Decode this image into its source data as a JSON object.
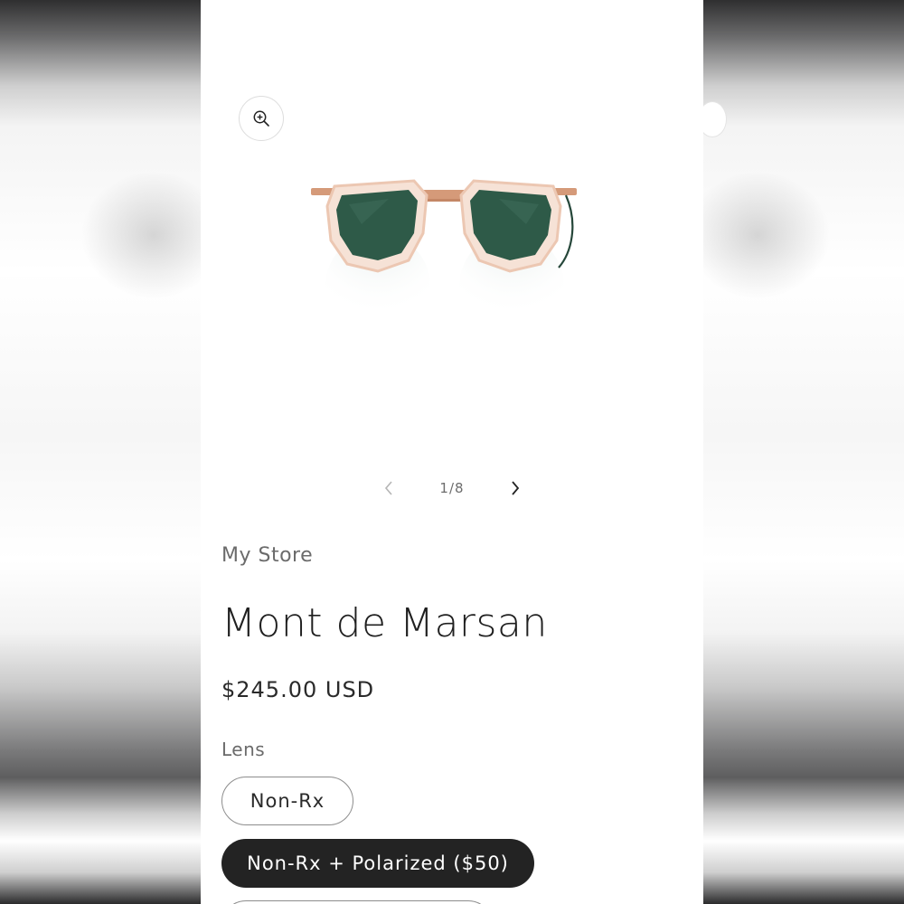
{
  "slider": {
    "counter": "1/8"
  },
  "product": {
    "store": "My Store",
    "title": "Mont de Marsan",
    "price": "$245.00 USD"
  },
  "options": {
    "label": "Lens",
    "values": [
      {
        "label": "Non-Rx",
        "selected": false
      },
      {
        "label": "Non-Rx + Polarized ($50)",
        "selected": true
      },
      {
        "label": "",
        "selected": false
      }
    ]
  },
  "icons": {
    "zoom": "zoom-in-icon",
    "prev": "chevron-left-icon",
    "next": "chevron-right-icon"
  },
  "colors": {
    "selected_bg": "#232323",
    "lens": "#2e5a48",
    "frame": "#f2d7c6",
    "metal": "#d59a79"
  }
}
